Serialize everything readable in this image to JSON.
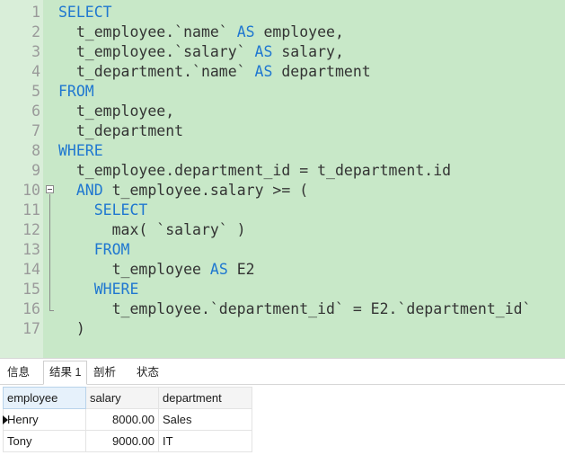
{
  "editor": {
    "lines": [
      {
        "n": "1",
        "tokens": [
          {
            "t": "SELECT",
            "kw": true
          }
        ]
      },
      {
        "n": "2",
        "tokens": [
          {
            "t": "  t_employee.`name` ",
            "kw": false
          },
          {
            "t": "AS",
            "kw": true
          },
          {
            "t": " employee,",
            "kw": false
          }
        ]
      },
      {
        "n": "3",
        "tokens": [
          {
            "t": "  t_employee.`salary` ",
            "kw": false
          },
          {
            "t": "AS",
            "kw": true
          },
          {
            "t": " salary,",
            "kw": false
          }
        ]
      },
      {
        "n": "4",
        "tokens": [
          {
            "t": "  t_department.`name` ",
            "kw": false
          },
          {
            "t": "AS",
            "kw": true
          },
          {
            "t": " department",
            "kw": false
          }
        ]
      },
      {
        "n": "5",
        "tokens": [
          {
            "t": "FROM",
            "kw": true
          }
        ]
      },
      {
        "n": "6",
        "tokens": [
          {
            "t": "  t_employee,",
            "kw": false
          }
        ]
      },
      {
        "n": "7",
        "tokens": [
          {
            "t": "  t_department",
            "kw": false
          }
        ]
      },
      {
        "n": "8",
        "tokens": [
          {
            "t": "WHERE",
            "kw": true
          }
        ]
      },
      {
        "n": "9",
        "tokens": [
          {
            "t": "  t_employee.department_id = t_department.id",
            "kw": false
          }
        ]
      },
      {
        "n": "10",
        "tokens": [
          {
            "t": "  ",
            "kw": false
          },
          {
            "t": "AND",
            "kw": true
          },
          {
            "t": " t_employee.salary >= (",
            "kw": false
          }
        ]
      },
      {
        "n": "11",
        "tokens": [
          {
            "t": "    ",
            "kw": false
          },
          {
            "t": "SELECT",
            "kw": true
          }
        ]
      },
      {
        "n": "12",
        "tokens": [
          {
            "t": "      max( `salary` )",
            "kw": false
          }
        ]
      },
      {
        "n": "13",
        "tokens": [
          {
            "t": "    ",
            "kw": false
          },
          {
            "t": "FROM",
            "kw": true
          }
        ]
      },
      {
        "n": "14",
        "tokens": [
          {
            "t": "      t_employee ",
            "kw": false
          },
          {
            "t": "AS",
            "kw": true
          },
          {
            "t": " E2",
            "kw": false
          }
        ]
      },
      {
        "n": "15",
        "tokens": [
          {
            "t": "    ",
            "kw": false
          },
          {
            "t": "WHERE",
            "kw": true
          }
        ]
      },
      {
        "n": "16",
        "tokens": [
          {
            "t": "      t_employee.`department_id` = E2.`department_id`",
            "kw": false
          }
        ]
      },
      {
        "n": "17",
        "tokens": [
          {
            "t": "  )",
            "kw": false
          }
        ]
      }
    ]
  },
  "tabs": {
    "info": "信息",
    "result1": "结果 1",
    "profile": "剖析",
    "status": "状态"
  },
  "grid": {
    "columns": [
      "employee",
      "salary",
      "department"
    ],
    "rows": [
      [
        "Henry",
        "8000.00",
        "Sales"
      ],
      [
        "Tony",
        "9000.00",
        "IT"
      ]
    ]
  }
}
